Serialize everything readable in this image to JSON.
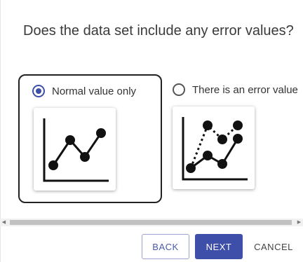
{
  "question": "Does the data set include any error values?",
  "options": [
    {
      "label": "Normal value only",
      "selected": true,
      "icon": "line-chart-icon"
    },
    {
      "label": "There is an error value",
      "selected": false,
      "icon": "line-chart-error-icon"
    }
  ],
  "buttons": {
    "back": "BACK",
    "next": "NEXT",
    "cancel": "CANCEL"
  },
  "colors": {
    "accent": "#3d4fa8",
    "selected_border": "#222222"
  }
}
